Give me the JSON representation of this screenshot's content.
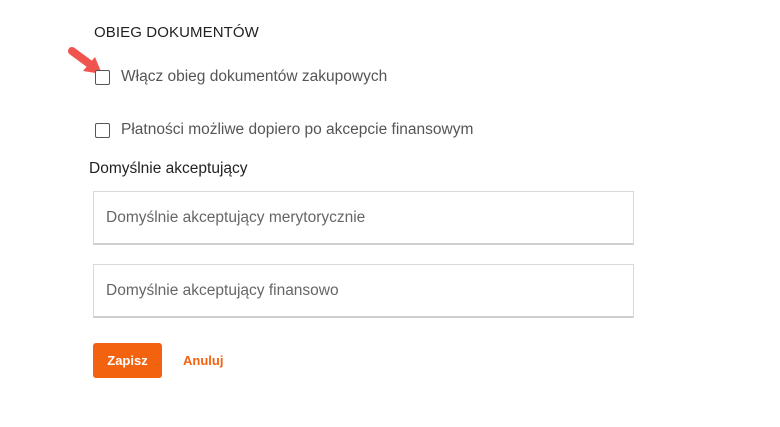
{
  "section": {
    "title": "OBIEG DOKUMENTÓW"
  },
  "options": [
    {
      "label": "Włącz obieg dokumentów zakupowych",
      "checked": false
    },
    {
      "label": "Płatności możliwe dopiero po akcepcie finansowym",
      "checked": false
    }
  ],
  "default_approvers": {
    "heading": "Domyślnie akceptujący",
    "substantive_placeholder": "Domyślnie akceptujący merytorycznie",
    "substantive_value": "",
    "financial_placeholder": "Domyślnie akceptujący finansowo",
    "financial_value": ""
  },
  "actions": {
    "save_label": "Zapisz",
    "cancel_label": "Anuluj"
  },
  "colors": {
    "accent": "#f2620f",
    "pointer_arrow": "#f0544f"
  },
  "icons": {
    "pointer": "arrow-pointer-icon"
  }
}
